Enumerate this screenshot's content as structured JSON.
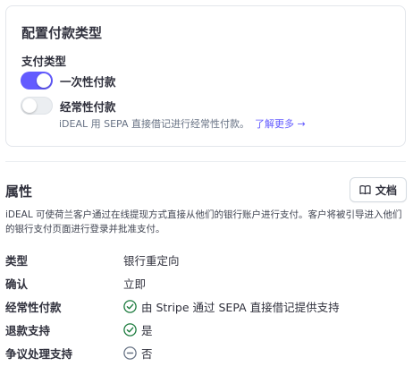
{
  "config": {
    "title": "配置付款类型",
    "section_label": "支付类型",
    "options": [
      {
        "label": "一次性付款",
        "enabled": true
      },
      {
        "label": "经常性付款",
        "enabled": false
      }
    ],
    "recurring_description": "iDEAL 用 SEPA 直接借记进行经常性付款。",
    "learn_more": "了解更多 →"
  },
  "properties": {
    "title": "属性",
    "docs_button": "文档",
    "description": "iDEAL 可使荷兰客户通过在线提现方式直接从他们的银行账户进行支付。客户将被引导进入他们的银行支付页面进行登录并批准支付。",
    "rows": [
      {
        "key": "类型",
        "value": "银行重定向",
        "icon": "none"
      },
      {
        "key": "确认",
        "value": "立即",
        "icon": "none"
      },
      {
        "key": "经常性付款",
        "value": "由 Stripe 通过 SEPA 直接借记提供支持",
        "icon": "check-circle-icon"
      },
      {
        "key": "退款支持",
        "value": "是",
        "icon": "check-circle-icon"
      },
      {
        "key": "争议处理支持",
        "value": "否",
        "icon": "minus-circle-icon"
      }
    ]
  },
  "colors": {
    "accent": "#635bff",
    "check": "#1a7a3c",
    "muted": "#687385"
  }
}
